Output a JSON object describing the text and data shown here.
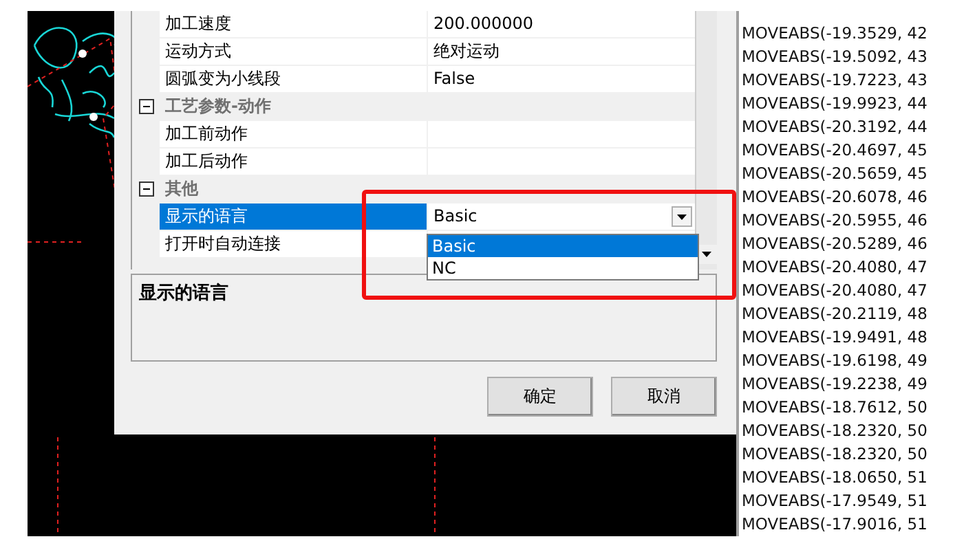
{
  "property_grid": {
    "rows": [
      {
        "kind": "property",
        "label": "加工速度",
        "value": "200.000000",
        "selected": false
      },
      {
        "kind": "property",
        "label": "运动方式",
        "value": "绝对运动",
        "selected": false
      },
      {
        "kind": "property",
        "label": "圆弧变为小线段",
        "value": "False",
        "selected": false
      },
      {
        "kind": "category",
        "label": "工艺参数-动作",
        "expanded": true
      },
      {
        "kind": "property",
        "label": "加工前动作",
        "selected": false
      },
      {
        "kind": "property",
        "label": "加工后动作",
        "selected": false
      },
      {
        "kind": "category",
        "label": "其他",
        "expanded": true
      },
      {
        "kind": "dropdown",
        "label": "显示的语言",
        "value": "Basic",
        "selected": true,
        "open": true,
        "options": [
          {
            "label": "Basic",
            "selected": true
          },
          {
            "label": "NC",
            "selected": false
          }
        ]
      },
      {
        "kind": "property",
        "label": "打开时自动连接",
        "selected": false
      }
    ]
  },
  "description": {
    "title": "显示的语言"
  },
  "buttons": [
    "确定",
    "取消"
  ],
  "output_lines": [
    "MOVEABS(-19.3529, 42",
    "MOVEABS(-19.5092, 43",
    "MOVEABS(-19.7223, 43",
    "MOVEABS(-19.9923, 44",
    "MOVEABS(-20.3192, 44",
    "MOVEABS(-20.4697, 45",
    "MOVEABS(-20.5659, 45",
    "MOVEABS(-20.6078, 46",
    "MOVEABS(-20.5955, 46",
    "MOVEABS(-20.5289, 46",
    "MOVEABS(-20.4080, 47",
    "MOVEABS(-20.4080, 47",
    "MOVEABS(-20.2119, 48",
    "MOVEABS(-19.9491, 48",
    "MOVEABS(-19.6198, 49",
    "MOVEABS(-19.2238, 49",
    "MOVEABS(-18.7612, 50",
    "MOVEABS(-18.2320, 50",
    "MOVEABS(-18.2320, 50",
    "MOVEABS(-18.0650, 51",
    "MOVEABS(-17.9549, 51",
    "MOVEABS(-17.9016, 51"
  ]
}
